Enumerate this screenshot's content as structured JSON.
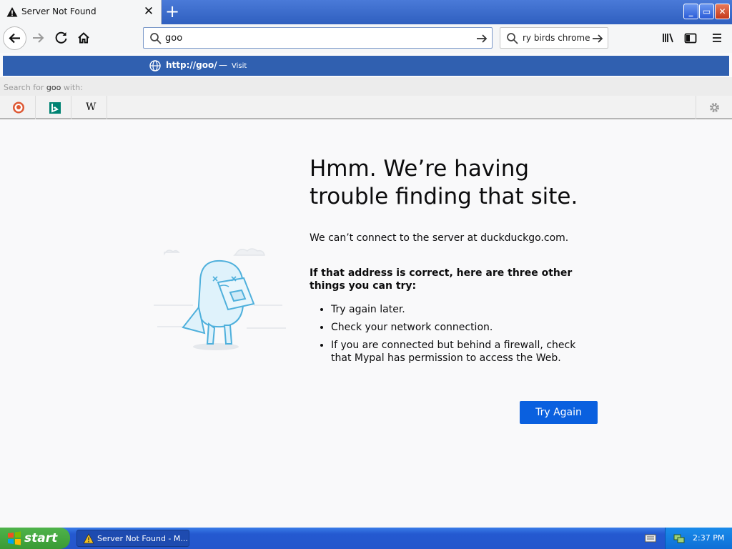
{
  "browser": {
    "tab": {
      "title": "Server Not Found"
    },
    "url_input": {
      "value": "goo"
    },
    "search_box": {
      "text": "ry birds chrome"
    },
    "autocomplete": {
      "url": "http://goo/",
      "separator": "—",
      "action": "Visit",
      "search_prefix": "Search for",
      "search_term": "goo",
      "search_suffix": "with:",
      "engines": [
        "DuckDuckGo",
        "Bing",
        "W"
      ]
    }
  },
  "error_page": {
    "title": "Hmm. We’re having trouble finding that site.",
    "description": "We can’t connect to the server at duckduckgo.com.",
    "subtitle": "If that address is correct, here are three other things you can try:",
    "suggestions": [
      "Try again later.",
      "Check your network connection.",
      "If you are connected but behind a firewall, check that Mypal has permission to access the Web."
    ],
    "button": "Try Again"
  },
  "taskbar": {
    "start": "start",
    "item": "Server Not Found - M...",
    "clock": "2:37 PM"
  },
  "colors": {
    "accent": "#0a60df",
    "autocomplete_highlight": "#3060b0",
    "page_bg": "#f9f9fa"
  }
}
